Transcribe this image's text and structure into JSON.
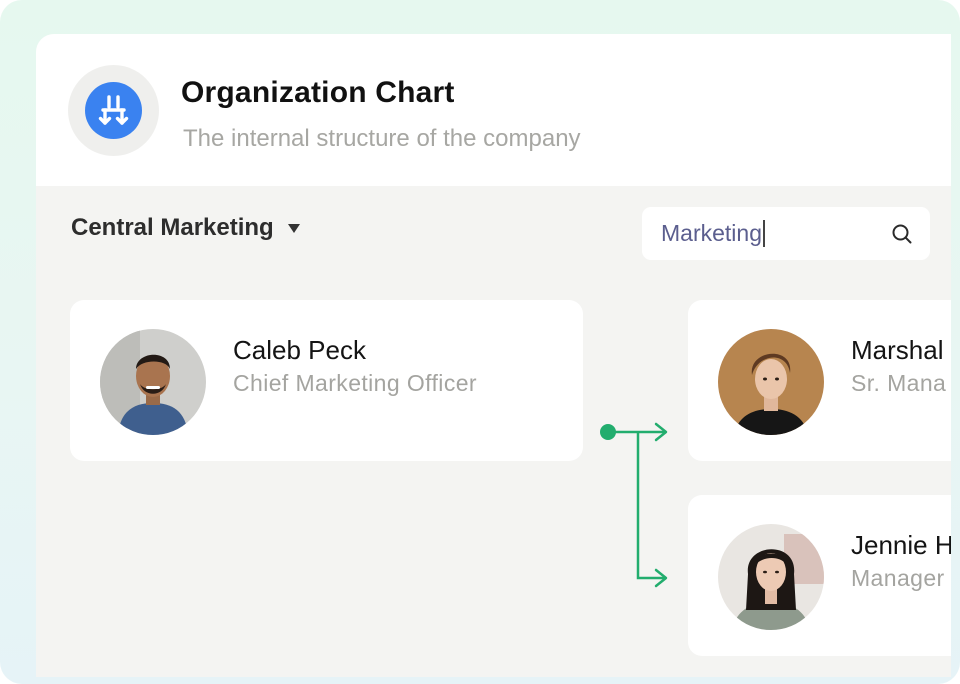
{
  "header": {
    "icon": "org-chart-icon",
    "title": "Organization Chart",
    "subtitle": "The internal structure of the company"
  },
  "department": {
    "label": "Central Marketing",
    "dropdown_icon": "caret-down-icon"
  },
  "search": {
    "value": "Marketing",
    "icon": "search-icon"
  },
  "people": [
    {
      "name": "Caleb Peck",
      "role": "Chief Marketing Officer"
    },
    {
      "name": "Marshal",
      "role": "Sr. Mana"
    },
    {
      "name": "Jennie H",
      "role": "Manager"
    }
  ],
  "colors": {
    "accent": "#3a82f0",
    "connector": "#22ad6e",
    "background": "#f4f4f2"
  }
}
